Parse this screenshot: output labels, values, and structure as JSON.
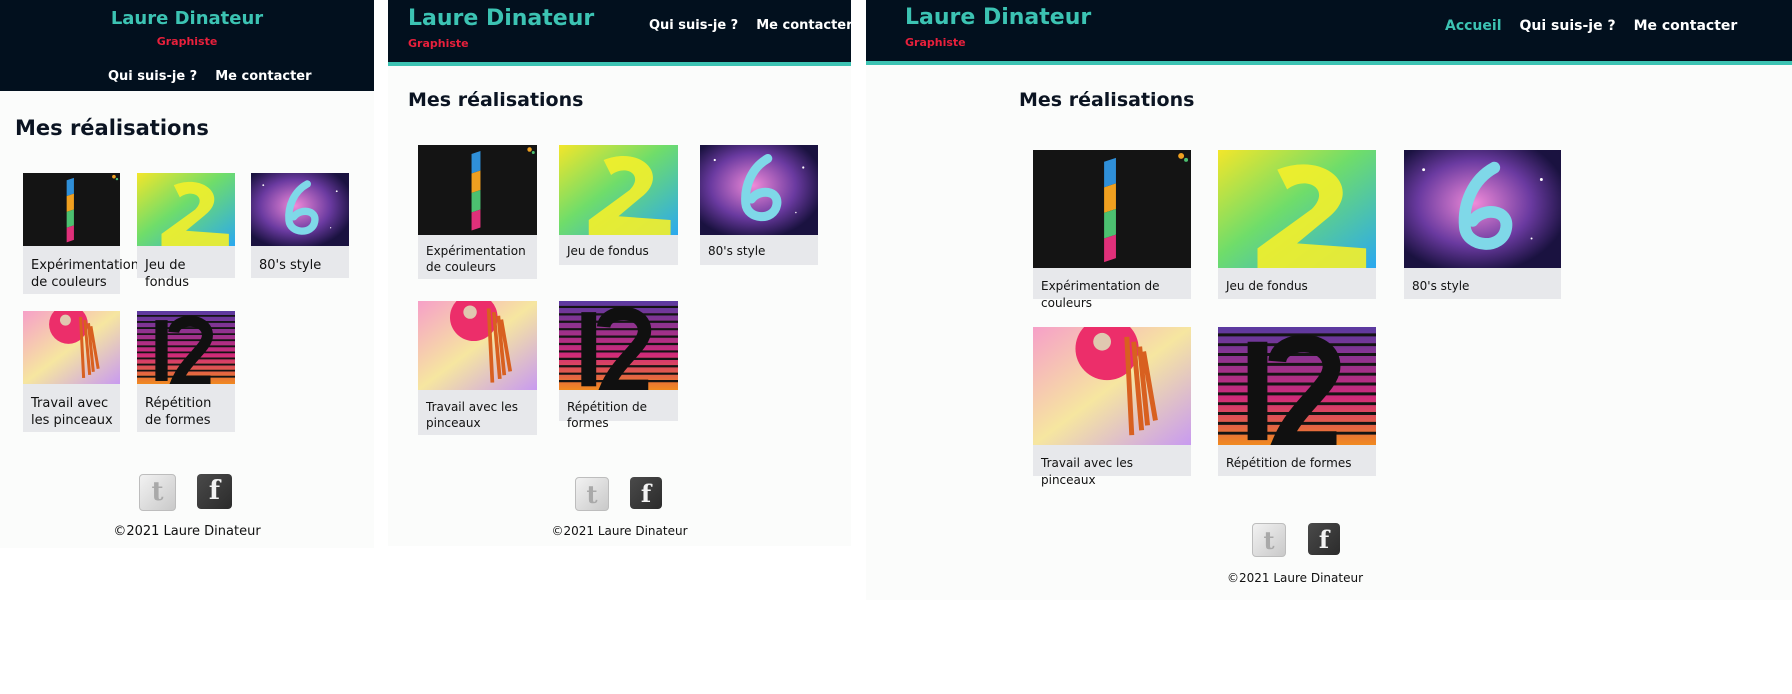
{
  "site": {
    "title": "Laure Dinateur",
    "subtitle": "Graphiste"
  },
  "nav": {
    "home": "Accueil",
    "about": "Qui suis-je ?",
    "contact": "Me contacter"
  },
  "section_title": "Mes réalisations",
  "projects": [
    {
      "caption": "Expérimentation de couleurs",
      "image": "colour-bars-numeral-one"
    },
    {
      "caption": "Jeu de fondus",
      "image": "gradient-numeral-two"
    },
    {
      "caption": "80's style",
      "image": "neon-numeral-six"
    },
    {
      "caption": "Travail avec les pinceaux",
      "image": "brush-numeral-nine"
    },
    {
      "caption": "Répétition de formes",
      "image": "striped-numeral-twelve"
    }
  ],
  "social": {
    "twitter_icon": "twitter-icon",
    "facebook_icon": "facebook-icon"
  },
  "footer": {
    "copyright": "©2021 Laure Dinateur"
  },
  "colors": {
    "header_bg": "#02101e",
    "brand": "#3cc3b3",
    "accent": "#e8203c",
    "card_bg": "#e7e8eb"
  }
}
